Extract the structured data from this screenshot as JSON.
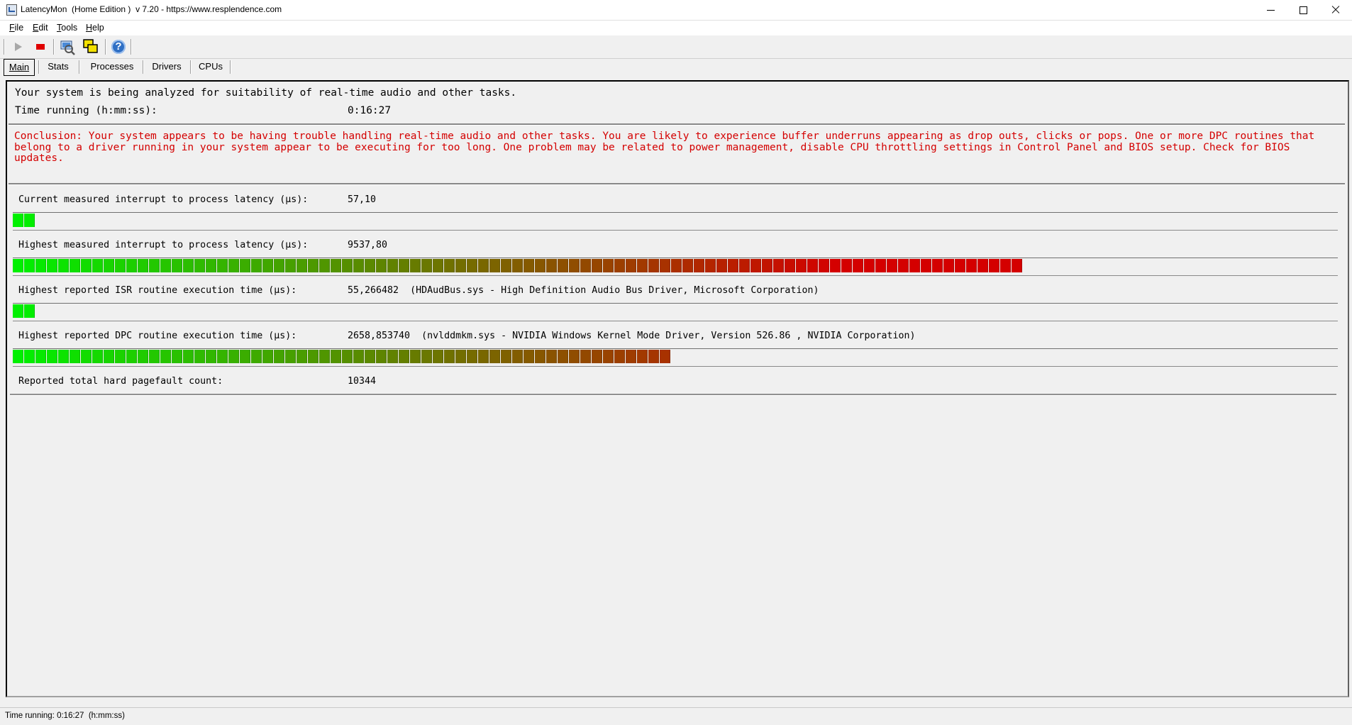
{
  "window": {
    "title": "LatencyMon  (Home Edition )  v 7.20 - https://www.resplendence.com"
  },
  "menu": {
    "items": [
      {
        "label": "File",
        "accel": "F",
        "rest": "ile"
      },
      {
        "label": "Edit",
        "accel": "E",
        "rest": "dit"
      },
      {
        "label": "Tools",
        "accel": "T",
        "rest": "ools"
      },
      {
        "label": "Help",
        "accel": "H",
        "rest": "elp"
      }
    ]
  },
  "toolbar": {
    "buttons": [
      "play-icon",
      "stop-icon",
      "analyze-icon",
      "windows-icon",
      "help-icon"
    ]
  },
  "tabs": [
    {
      "label": "Main",
      "active": true
    },
    {
      "label": "Stats",
      "active": false
    },
    {
      "label": "Processes",
      "active": false
    },
    {
      "label": "Drivers",
      "active": false
    },
    {
      "label": "CPUs",
      "active": false
    }
  ],
  "main": {
    "status_line": "Your system is being analyzed for suitability of real-time audio and other tasks.",
    "time_label": "Time running (h:mm:ss):",
    "time_value": "0:16:27",
    "conclusion": "Conclusion: Your system appears to be having trouble handling real-time audio and other tasks. You are likely to experience buffer underruns appearing as drop outs, clicks or pops. One or more DPC routines that belong to a driver running in your system appear to be executing for too long. One problem may be related to power management, disable CPU throttling settings in Control Panel and BIOS setup. Check for BIOS updates.",
    "metrics": [
      {
        "label": "Current measured interrupt to process latency (µs):",
        "value": "57,10",
        "detail": "",
        "level": 0.016
      },
      {
        "label": "Highest measured interrupt to process latency (µs):",
        "value": "9537,80",
        "detail": "",
        "level": 0.763
      },
      {
        "label": "Highest reported ISR routine execution time (µs):",
        "value": "55,266482",
        "detail": "(HDAudBus.sys - High Definition Audio Bus Driver, Microsoft Corporation)",
        "level": 0.016
      },
      {
        "label": "Highest reported DPC routine execution time (µs):",
        "value": "2658,853740",
        "detail": "(nvlddmkm.sys - NVIDIA Windows Kernel Mode Driver, Version 526.86 , NVIDIA Corporation)",
        "level": 0.498
      },
      {
        "label": "Reported total hard pagefault count:",
        "value": "10344",
        "detail": "",
        "level": 0
      }
    ]
  },
  "statusbar": {
    "text": "Time running: 0:16:27  (h:mm:ss)"
  },
  "colors": {
    "conclusion": "#d40000",
    "bar_low": "#00f000",
    "bar_high": "#d40000"
  }
}
